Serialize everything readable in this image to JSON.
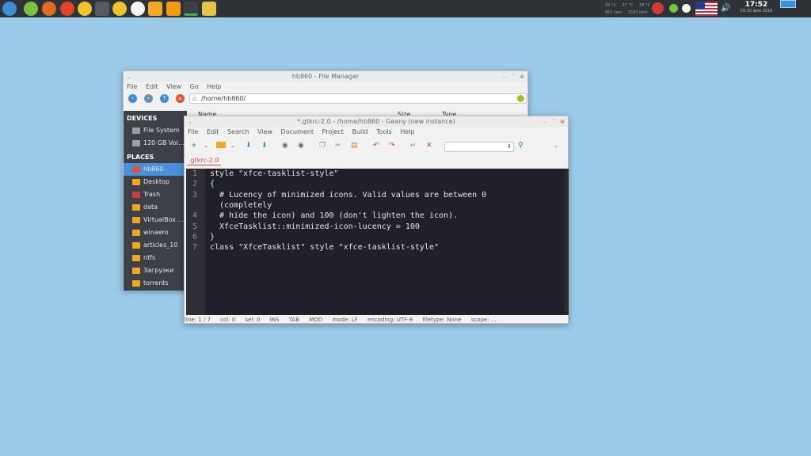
{
  "panel": {
    "temps": [
      "33 °C",
      "27 °C",
      "28 °C"
    ],
    "fan": [
      "951 rpm",
      "1597 rpm"
    ],
    "clock": {
      "time": "17:52",
      "date": "Сб 20 фев 2016"
    }
  },
  "file_manager": {
    "title": "hb860 - File Manager",
    "menu": [
      "File",
      "Edit",
      "View",
      "Go",
      "Help"
    ],
    "path": "/home/hb860/",
    "headers": {
      "name": "Name",
      "size": "Size",
      "type": "Type"
    },
    "devices_label": "DEVICES",
    "devices": [
      "File System",
      "120 GB Vol..."
    ],
    "places_label": "PLACES",
    "places": [
      "hb860",
      "Desktop",
      "Trash",
      "data",
      "VirtualBox ...",
      "winaero",
      "articles_10",
      "ntfs",
      "Загрузки",
      "torrents"
    ]
  },
  "geany": {
    "title": "*.gtkrc-2.0 - /home/hb860 - Geany (new instance)",
    "menu": [
      "File",
      "Edit",
      "Search",
      "View",
      "Document",
      "Project",
      "Build",
      "Tools",
      "Help"
    ],
    "tab": ".gtkrc-2.0",
    "lines": [
      {
        "n": "1",
        "text": "style \"xfce-tasklist-style\""
      },
      {
        "n": "2",
        "text": "{"
      },
      {
        "n": "3",
        "text": "  # Lucency of minimized icons. Valid values are between 0"
      },
      {
        "n": "",
        "text": "  (completely"
      },
      {
        "n": "4",
        "text": "  # hide the icon) and 100 (don't lighten the icon)."
      },
      {
        "n": "5",
        "text": "  XfceTasklist::minimized-icon-lucency = 100"
      },
      {
        "n": "6",
        "text": "}"
      },
      {
        "n": "7",
        "text": "class \"XfceTasklist\" style \"xfce-tasklist-style\""
      }
    ],
    "status": [
      "line: 1 / 7",
      "col: 0",
      "sel: 0",
      "INS",
      "TAB",
      "MOD",
      "mode: LF",
      "encoding: UTF-8",
      "filetype: None",
      "scope: ..."
    ]
  }
}
